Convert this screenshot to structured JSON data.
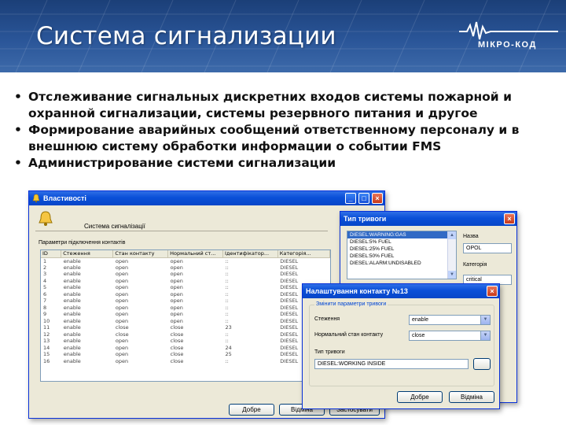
{
  "slide": {
    "title": "Система сигнализации",
    "logo_text": "МІКРО-КОД",
    "bullets": [
      [
        "Отслеживание сигнальных дискретних входов системы пожарной и",
        "охранной сигнализации, системы резервного питания и другое"
      ],
      [
        "Формирование аварийных сообщений ответственному персоналу и в",
        "внешнюю систему обработки информации о событии FMS"
      ],
      [
        "Администрирование системи сигнализации"
      ]
    ]
  },
  "main_window": {
    "title": "Властивості",
    "heading": "Система сигналізації",
    "section_label": "Параметри підключення контактів",
    "columns": [
      "ID",
      "Стеження",
      "Стан контакту",
      "Нормальний ст...",
      "Ідентифікатор...",
      "Категорія..."
    ],
    "rows": [
      [
        "1",
        "enable",
        "open",
        "open",
        "::",
        "DIESEL"
      ],
      [
        "2",
        "enable",
        "open",
        "open",
        "::",
        "DIESEL"
      ],
      [
        "3",
        "enable",
        "open",
        "open",
        "::",
        "DIESEL"
      ],
      [
        "4",
        "enable",
        "open",
        "open",
        "::",
        "DIESEL"
      ],
      [
        "5",
        "enable",
        "open",
        "open",
        "::",
        "DIESEL"
      ],
      [
        "6",
        "enable",
        "open",
        "open",
        "::",
        "DIESEL"
      ],
      [
        "7",
        "enable",
        "open",
        "open",
        "::",
        "DIESEL"
      ],
      [
        "8",
        "enable",
        "open",
        "open",
        "::",
        "DIESEL"
      ],
      [
        "9",
        "enable",
        "open",
        "open",
        "::",
        "DIESEL"
      ],
      [
        "10",
        "enable",
        "open",
        "open",
        "::",
        "DIESEL"
      ],
      [
        "11",
        "enable",
        "close",
        "close",
        "23",
        "DIESEL"
      ],
      [
        "12",
        "enable",
        "close",
        "close",
        "::",
        "DIESEL"
      ],
      [
        "13",
        "enable",
        "open",
        "close",
        "::",
        "DIESEL"
      ],
      [
        "14",
        "enable",
        "open",
        "close",
        "24",
        "DIESEL"
      ],
      [
        "15",
        "enable",
        "open",
        "close",
        "25",
        "DIESEL"
      ],
      [
        "16",
        "enable",
        "open",
        "close",
        "::",
        "DIESEL"
      ]
    ],
    "buttons": {
      "ok": "Добре",
      "cancel": "Відміна",
      "apply": "Застосувати"
    }
  },
  "alarm_type_window": {
    "title": "Тип тривоги",
    "list": [
      "DIESEL:WARNING:GAS",
      "DIESEL:5% FUEL",
      "DIESEL:25% FUEL",
      "DIESEL:50% FUEL",
      "DIESEL:ALARM:UNDISABLED"
    ],
    "selected_index": 0,
    "label_name": "Назва",
    "name_value": "OPOL",
    "label_category": "Категорія",
    "category_value": "critical"
  },
  "contact_window": {
    "title": "Налаштування контакту №13",
    "group_label": "Змінити параметри тривоги",
    "fields": {
      "tracking_label": "Стеження",
      "tracking_value": "enable",
      "normal_state_label": "Нормальний стан контакту",
      "normal_state_value": "close",
      "alarm_type_label": "Тип тривоги",
      "alarm_type_value": "DIESEL:WORKING INSIDE"
    },
    "buttons": {
      "ok": "Добре",
      "cancel": "Відміна"
    }
  },
  "colors": {
    "header_bg": "#2a5598",
    "xp_title": "#0a4fd8",
    "window_bg": "#ece9d8"
  }
}
